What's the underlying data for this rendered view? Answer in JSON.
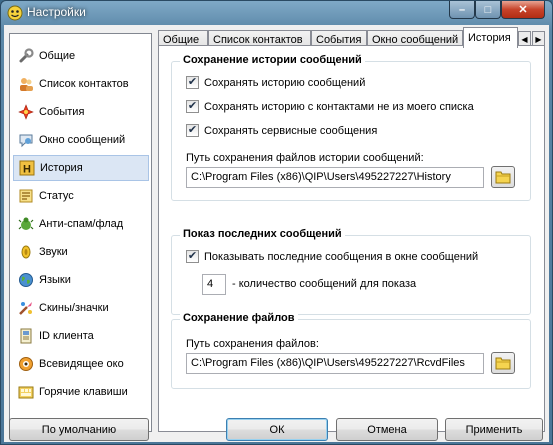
{
  "window": {
    "title": "Настройки"
  },
  "titlebar": {
    "minimize": "–",
    "maximize": "□",
    "close": "✕"
  },
  "sidebar": {
    "items": [
      {
        "label": "Общие",
        "icon": "wrench-icon"
      },
      {
        "label": "Список контактов",
        "icon": "contacts-icon"
      },
      {
        "label": "События",
        "icon": "events-icon"
      },
      {
        "label": "Окно сообщений",
        "icon": "message-window-icon"
      },
      {
        "label": "История",
        "icon": "history-icon",
        "selected": true
      },
      {
        "label": "Статус",
        "icon": "status-icon"
      },
      {
        "label": "Анти-спам/флад",
        "icon": "antispam-icon"
      },
      {
        "label": "Звуки",
        "icon": "sounds-icon"
      },
      {
        "label": "Языки",
        "icon": "languages-icon"
      },
      {
        "label": "Скины/значки",
        "icon": "skins-icon"
      },
      {
        "label": "ID клиента",
        "icon": "client-id-icon"
      },
      {
        "label": "Всевидящее око",
        "icon": "all-seeing-eye-icon"
      },
      {
        "label": "Горячие клавиши",
        "icon": "hotkeys-icon"
      }
    ]
  },
  "tabs": [
    {
      "label": "Общие"
    },
    {
      "label": "Список контактов"
    },
    {
      "label": "События"
    },
    {
      "label": "Окно сообщений"
    },
    {
      "label": "История",
      "active": true
    }
  ],
  "tab_scroll": {
    "left": "◀",
    "right": "▶"
  },
  "save_history": {
    "title": "Сохранение истории сообщений",
    "options": [
      {
        "label": "Сохранять историю сообщений",
        "checked": true
      },
      {
        "label": "Сохранять историю с контактами не из моего списка",
        "checked": true
      },
      {
        "label": "Сохранять сервисные сообщения",
        "checked": true
      }
    ],
    "path_label": "Путь сохранения файлов истории сообщений:",
    "path_value": "C:\\Program Files (x86)\\QIP\\Users\\495227227\\History"
  },
  "recent_messages": {
    "title": "Показ последних сообщений",
    "option": {
      "label": "Показывать последние сообщения в окне сообщений",
      "checked": true
    },
    "count_value": "4",
    "count_label": "- количество сообщений для показа"
  },
  "file_saving": {
    "title": "Сохранение файлов",
    "path_label": "Путь сохранения файлов:",
    "path_value": "C:\\Program Files (x86)\\QIP\\Users\\495227227\\RcvdFiles"
  },
  "buttons": {
    "defaults": "По умолчанию",
    "ok": "ОК",
    "cancel": "Отмена",
    "apply": "Применить"
  },
  "check_glyph": "✔"
}
